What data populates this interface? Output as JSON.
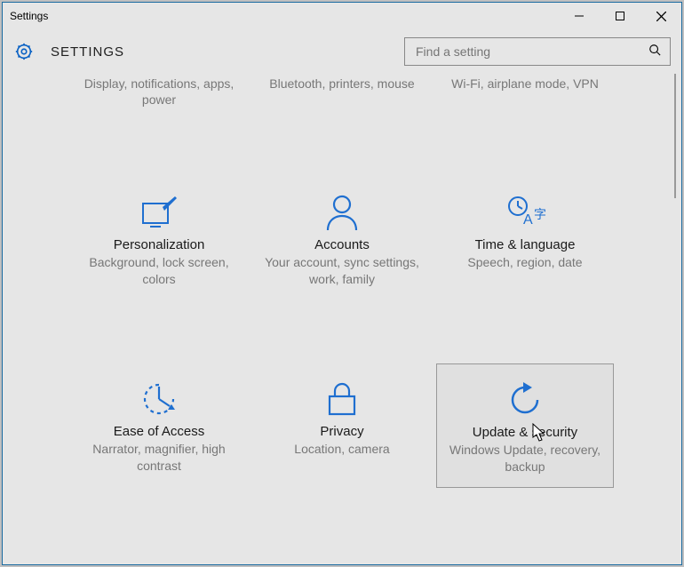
{
  "window": {
    "title": "Settings"
  },
  "header": {
    "title": "SETTINGS",
    "search_placeholder": "Find a setting"
  },
  "partial_row": [
    {
      "desc": "Display, notifications, apps, power"
    },
    {
      "desc": "Bluetooth, printers, mouse"
    },
    {
      "desc": "Wi-Fi, airplane mode, VPN"
    }
  ],
  "tiles": [
    {
      "name": "Personalization",
      "desc": "Background, lock screen, colors"
    },
    {
      "name": "Accounts",
      "desc": "Your account, sync settings, work, family"
    },
    {
      "name": "Time & language",
      "desc": "Speech, region, date"
    },
    {
      "name": "Ease of Access",
      "desc": "Narrator, magnifier, high contrast"
    },
    {
      "name": "Privacy",
      "desc": "Location, camera"
    },
    {
      "name": "Update & security",
      "desc": "Windows Update, recovery, backup"
    }
  ]
}
